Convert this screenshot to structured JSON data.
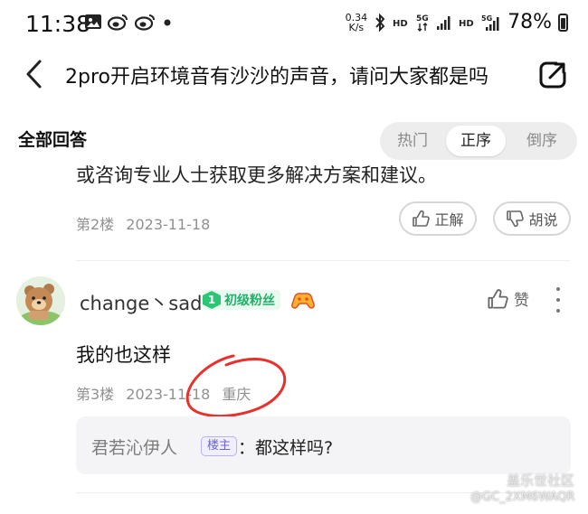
{
  "status_bar": {
    "time": "11:38",
    "net_speed": "0.34",
    "net_unit": "K/s",
    "battery": "78%"
  },
  "header": {
    "title": "2pro开启环境音有沙沙的声音，请问大家都是吗"
  },
  "filter": {
    "section_title": "全部回答",
    "options": [
      "热门",
      "正序",
      "倒序"
    ],
    "active": "正序"
  },
  "answers": [
    {
      "partial_text": "或咨询专业人士获取更多解决方案和建议。",
      "floor": "第2楼",
      "date": "2023-11-18",
      "buttons": [
        "正解",
        "胡说"
      ]
    },
    {
      "username": "change丶sad",
      "level": "1",
      "level_label": "初级粉丝",
      "like_label": "赞",
      "text": "我的也这样",
      "floor": "第3楼",
      "date": "2023-11-18",
      "location": "重庆",
      "reply": {
        "name": "君若沁伊人",
        "badge": "楼主",
        "text": "：都这样吗?"
      }
    }
  ],
  "watermark": {
    "brand": "盖乐世社区",
    "user": "@GC_2XM6WAQR"
  }
}
